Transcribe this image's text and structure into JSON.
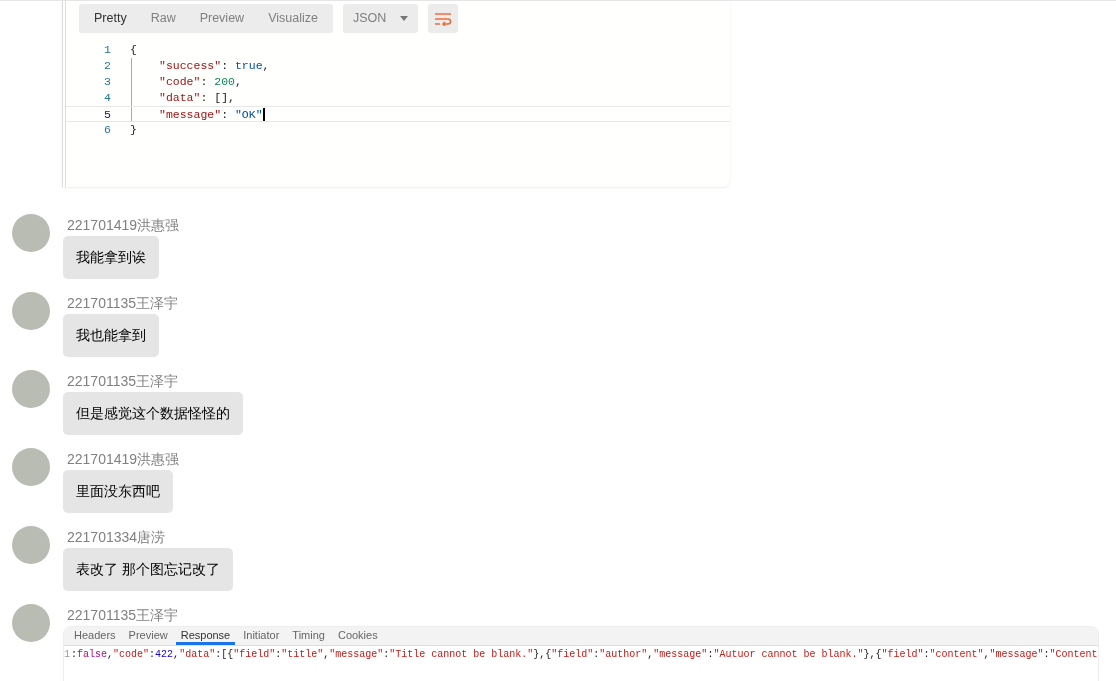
{
  "top_screenshot": {
    "tabs": [
      {
        "label": "Pretty",
        "selected": true
      },
      {
        "label": "Raw",
        "selected": false
      },
      {
        "label": "Preview",
        "selected": false
      },
      {
        "label": "Visualize",
        "selected": false
      }
    ],
    "format": "JSON",
    "lines": [
      {
        "number": "1",
        "active": false,
        "indent": false,
        "tokens": [
          {
            "text": "{",
            "kind": "punct"
          }
        ]
      },
      {
        "number": "2",
        "active": false,
        "indent": true,
        "tokens": [
          {
            "text": "\"success\"",
            "kind": "key"
          },
          {
            "text": ": ",
            "kind": "punct"
          },
          {
            "text": "true",
            "kind": "bool"
          },
          {
            "text": ",",
            "kind": "punct"
          }
        ]
      },
      {
        "number": "3",
        "active": false,
        "indent": true,
        "tokens": [
          {
            "text": "\"code\"",
            "kind": "key"
          },
          {
            "text": ": ",
            "kind": "punct"
          },
          {
            "text": "200",
            "kind": "num"
          },
          {
            "text": ",",
            "kind": "punct"
          }
        ]
      },
      {
        "number": "4",
        "active": false,
        "indent": true,
        "tokens": [
          {
            "text": "\"data\"",
            "kind": "key"
          },
          {
            "text": ": [],",
            "kind": "punct"
          }
        ]
      },
      {
        "number": "5",
        "active": true,
        "indent": true,
        "tokens": [
          {
            "text": "\"message\"",
            "kind": "key"
          },
          {
            "text": ": ",
            "kind": "punct"
          },
          {
            "text": "\"OK\"",
            "kind": "str"
          }
        ]
      },
      {
        "number": "6",
        "active": false,
        "indent": false,
        "tokens": [
          {
            "text": "}",
            "kind": "punct"
          }
        ]
      }
    ]
  },
  "messages": [
    {
      "sender": "221701419洪惠强",
      "text": "我能拿到诶"
    },
    {
      "sender": "221701135王泽宇",
      "text": "我也能拿到"
    },
    {
      "sender": "221701135王泽宇",
      "text": "但是感觉这个数据怪怪的"
    },
    {
      "sender": "221701419洪惠强",
      "text": "里面没东西吧"
    },
    {
      "sender": "221701334唐涝",
      "text": "表改了 那个图忘记改了"
    },
    {
      "sender": "221701135王泽宇",
      "devtools": {
        "tabs": [
          {
            "label": "Headers",
            "selected": false
          },
          {
            "label": "Preview",
            "selected": false
          },
          {
            "label": "Response",
            "selected": true
          },
          {
            "label": "Initiator",
            "selected": false
          },
          {
            "label": "Timing",
            "selected": false
          },
          {
            "label": "Cookies",
            "selected": false
          }
        ],
        "line_number": "1",
        "tokens": [
          {
            "text": ":",
            "kind": "punct"
          },
          {
            "text": "false",
            "kind": "bool"
          },
          {
            "text": ",",
            "kind": "punct"
          },
          {
            "text": "\"code\"",
            "kind": "key"
          },
          {
            "text": ":",
            "kind": "punct"
          },
          {
            "text": "422",
            "kind": "num"
          },
          {
            "text": ",",
            "kind": "punct"
          },
          {
            "text": "\"data\"",
            "kind": "key"
          },
          {
            "text": ":[{",
            "kind": "punct"
          },
          {
            "text": "\"field\"",
            "kind": "key"
          },
          {
            "text": ":",
            "kind": "punct"
          },
          {
            "text": "\"title\"",
            "kind": "str"
          },
          {
            "text": ",",
            "kind": "punct"
          },
          {
            "text": "\"message\"",
            "kind": "key"
          },
          {
            "text": ":",
            "kind": "punct"
          },
          {
            "text": "\"Title cannot be blank.\"",
            "kind": "str"
          },
          {
            "text": "},{",
            "kind": "punct"
          },
          {
            "text": "\"field\"",
            "kind": "key"
          },
          {
            "text": ":",
            "kind": "punct"
          },
          {
            "text": "\"author\"",
            "kind": "str"
          },
          {
            "text": ",",
            "kind": "punct"
          },
          {
            "text": "\"message\"",
            "kind": "key"
          },
          {
            "text": ":",
            "kind": "punct"
          },
          {
            "text": "\"Autuor cannot be blank.\"",
            "kind": "str"
          },
          {
            "text": "},{",
            "kind": "punct"
          },
          {
            "text": "\"field\"",
            "kind": "key"
          },
          {
            "text": ":",
            "kind": "punct"
          },
          {
            "text": "\"content\"",
            "kind": "str"
          },
          {
            "text": ",",
            "kind": "punct"
          },
          {
            "text": "\"message\"",
            "kind": "key"
          },
          {
            "text": ":",
            "kind": "punct"
          },
          {
            "text": "\"Content",
            "kind": "str"
          }
        ]
      }
    }
  ]
}
